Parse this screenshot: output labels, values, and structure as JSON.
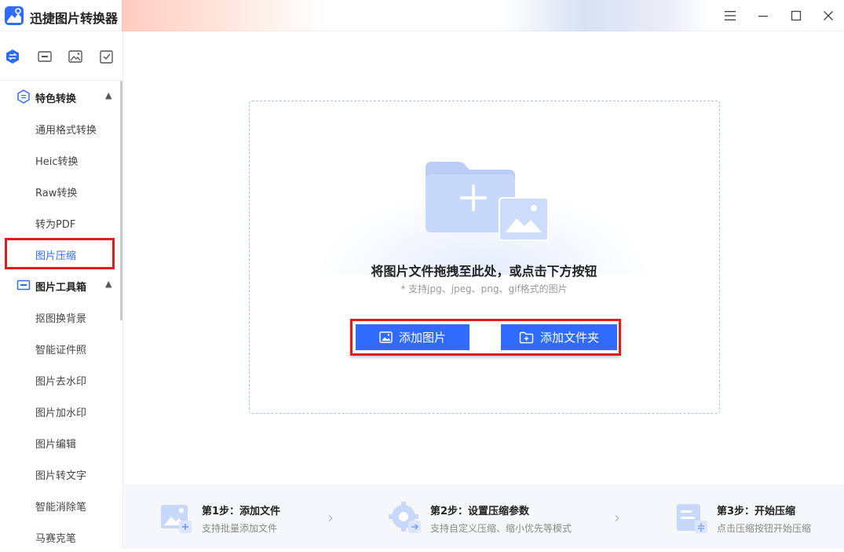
{
  "app": {
    "title": "迅捷图片转换器"
  },
  "window": {
    "menu_icon": "hamburger-icon",
    "minimize_icon": "minimize-icon",
    "maximize_icon": "maximize-icon",
    "close_icon": "close-icon"
  },
  "sidebar": {
    "tabs": [
      {
        "icon": "convert-icon",
        "active": true
      },
      {
        "icon": "toolbox-icon",
        "active": false
      },
      {
        "icon": "image-edit-icon",
        "active": false
      },
      {
        "icon": "checklist-icon",
        "active": false
      }
    ],
    "group1": {
      "label": "特色转换",
      "icon": "convert-icon"
    },
    "group1_items": [
      "通用格式转换",
      "Heic转换",
      "Raw转换",
      "转为PDF",
      "图片压缩"
    ],
    "group2": {
      "label": "图片工具箱",
      "icon": "toolbox-icon"
    },
    "group2_items": [
      "抠图换背景",
      "智能证件照",
      "图片去水印",
      "图片加水印",
      "图片编辑",
      "图片转文字",
      "智能消除笔",
      "马赛克笔"
    ]
  },
  "main": {
    "drop_title": "将图片文件拖拽至此处，或点击下方按钮",
    "drop_sub": "* 支持jpg、jpeg、png、gif格式的图片",
    "add_image_label": "添加图片",
    "add_folder_label": "添加文件夹"
  },
  "steps": [
    {
      "title": "第1步：添加文件",
      "desc": "支持批量添加文件",
      "icon": "add-image-icon"
    },
    {
      "title": "第2步：设置压缩参数",
      "desc": "支持自定义压缩、缩小优先等模式",
      "icon": "settings-gear-icon"
    },
    {
      "title": "第3步：开始压缩",
      "desc": "点击压缩按钮开始压缩",
      "icon": "compress-doc-icon"
    }
  ],
  "colors": {
    "accent": "#2f6bff",
    "highlight": "#e21b1b",
    "folder": "#b9cdf7"
  }
}
